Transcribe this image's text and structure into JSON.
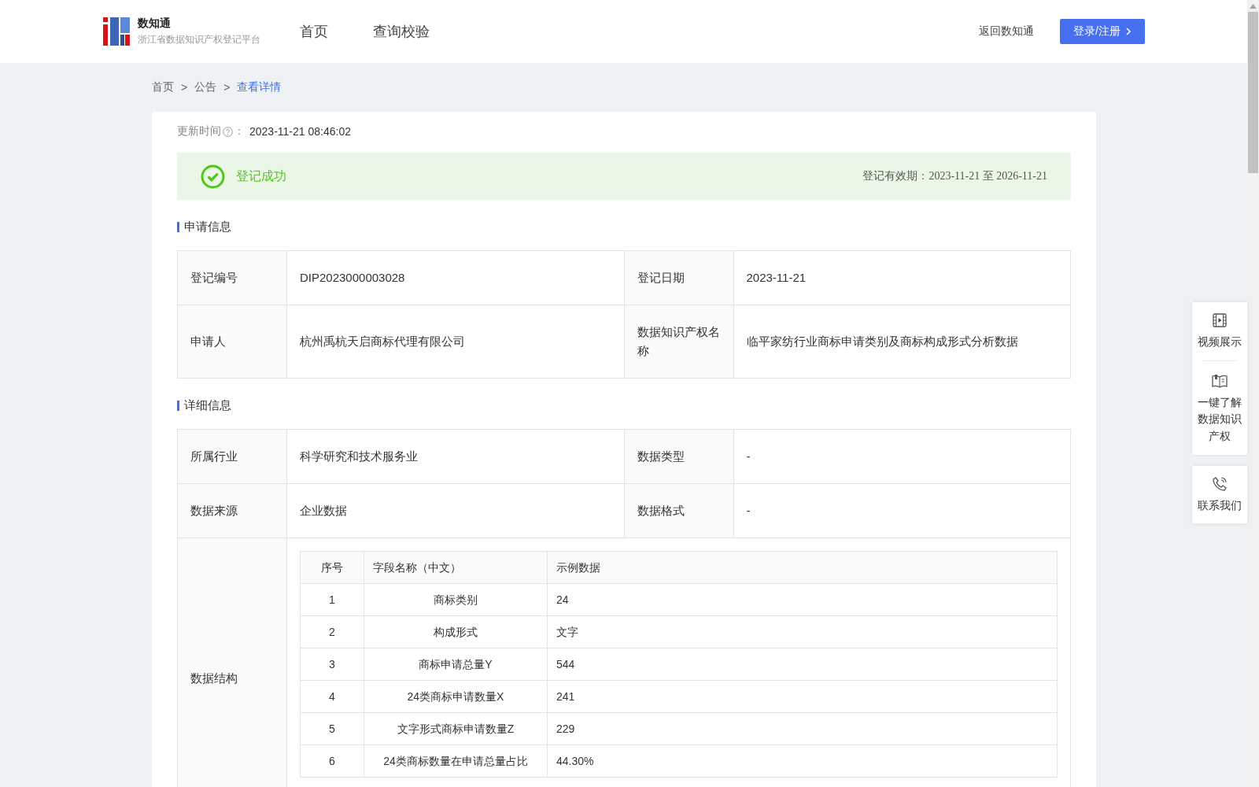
{
  "header": {
    "title": "数知通",
    "subtitle": "浙江省数据知识产权登记平台",
    "nav": [
      {
        "label": "首页"
      },
      {
        "label": "查询校验"
      }
    ],
    "back_link": "返回数知通",
    "login_button": "登录/注册"
  },
  "breadcrumb": [
    {
      "label": "首页",
      "current": false
    },
    {
      "label": "公告",
      "current": false
    },
    {
      "label": "查看详情",
      "current": true
    }
  ],
  "breadcrumb_separator": ">",
  "update": {
    "label": "更新时间",
    "separator": "：",
    "value": "2023-11-21 08:46:02"
  },
  "status": {
    "kind": "success",
    "text": "登记成功",
    "validity_label": "登记有效期：",
    "validity_value": "2023-11-21 至 2026-11-21"
  },
  "sections": [
    {
      "title": "申请信息",
      "rows": [
        {
          "kind": "pairs",
          "cells": [
            {
              "label": "登记编号",
              "value": "DIP2023000003028"
            },
            {
              "label": "登记日期",
              "value": "2023-11-21"
            }
          ]
        },
        {
          "kind": "pairs",
          "cells": [
            {
              "label": "申请人",
              "value": "杭州禹杭天启商标代理有限公司"
            },
            {
              "label": "数据知识产权名称",
              "value": "临平家纺行业商标申请类别及商标构成形式分析数据"
            }
          ]
        }
      ]
    },
    {
      "title": "详细信息",
      "rows": [
        {
          "kind": "pairs",
          "cells": [
            {
              "label": "所属行业",
              "value": "科学研究和技术服务业"
            },
            {
              "label": "数据类型",
              "value": "-"
            }
          ]
        },
        {
          "kind": "pairs",
          "cells": [
            {
              "label": "数据来源",
              "value": "企业数据"
            },
            {
              "label": "数据格式",
              "value": "-"
            }
          ]
        },
        {
          "kind": "table",
          "label": "数据结构",
          "columns": [
            "序号",
            "字段名称（中文）",
            "示例数据"
          ],
          "rows": [
            [
              "1",
              "商标类别",
              "24"
            ],
            [
              "2",
              "构成形式",
              "文字"
            ],
            [
              "3",
              "商标申请总量Y",
              "544"
            ],
            [
              "4",
              "24类商标申请数量X",
              "241"
            ],
            [
              "5",
              "文字形式商标申请数量Z",
              "229"
            ],
            [
              "6",
              "24类商标数量在申请总量占比",
              "44.30%"
            ]
          ]
        }
      ]
    }
  ],
  "float_panel": [
    {
      "items": [
        {
          "kind": "video",
          "label": "视频展示"
        },
        {
          "kind": "book",
          "label": "一键了解数据知识产权"
        }
      ]
    },
    {
      "items": [
        {
          "kind": "phone",
          "label": "联系我们"
        }
      ]
    }
  ]
}
